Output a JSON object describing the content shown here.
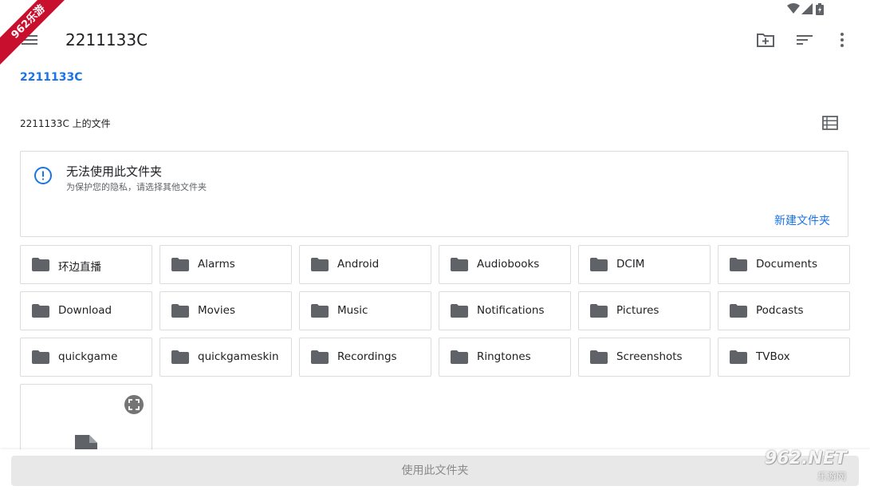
{
  "app_bar": {
    "title": "2211133C"
  },
  "breadcrumb": {
    "root": "2211133C"
  },
  "section": {
    "label": "2211133C 上的文件"
  },
  "notice": {
    "title": "无法使用此文件夹",
    "subtitle": "为保护您的隐私，请选择其他文件夹",
    "action_label": "新建文件夹"
  },
  "folders": [
    "环边直播",
    "Alarms",
    "Android",
    "Audiobooks",
    "DCIM",
    "Documents",
    "Download",
    "Movies",
    "Music",
    "Notifications",
    "Pictures",
    "Podcasts",
    "quickgame",
    "quickgameskin",
    "Recordings",
    "Ringtones",
    "Screenshots",
    "TVBox"
  ],
  "bottom": {
    "use_folder_label": "使用此文件夹"
  },
  "watermark": {
    "corner": "962乐游",
    "logo_main": "962.NET",
    "logo_sub": "乐游网"
  },
  "colors": {
    "accent": "#1a73e8",
    "folder_icon": "#5f6368",
    "border": "#dadce0"
  },
  "icons": {
    "menu": "hamburger-menu-icon",
    "new_folder": "create-new-folder-icon",
    "sort": "sort-icon",
    "more": "more-vert-icon",
    "view": "list-view-icon",
    "info": "info-icon",
    "folder": "folder-icon",
    "expand": "expand-icon",
    "document": "document-icon"
  }
}
